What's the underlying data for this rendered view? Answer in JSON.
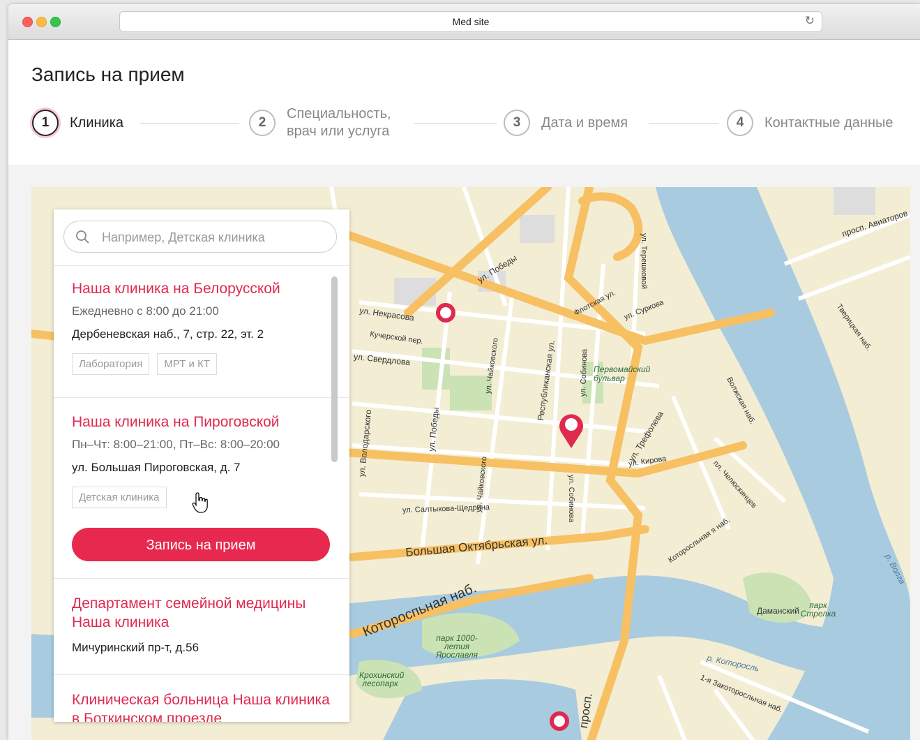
{
  "browser": {
    "url_title": "Med site"
  },
  "page": {
    "title": "Запись на прием"
  },
  "steps": [
    {
      "number": "1",
      "label": "Клиника"
    },
    {
      "number": "2",
      "label": "Специальность,\nврач или услуга"
    },
    {
      "number": "3",
      "label": "Дата и время"
    },
    {
      "number": "4",
      "label": "Контактные данные"
    }
  ],
  "search": {
    "placeholder": "Например, Детская клиника"
  },
  "clinics": [
    {
      "name": "Наша клиника на Белорусской",
      "hours": "Ежедневно с 8:00 до 21:00",
      "address": "Дербеневская наб., 7, стр. 22, эт. 2",
      "tags": [
        "Лаборатория",
        "МРТ и КТ"
      ]
    },
    {
      "name": "Наша клиника на Пироговской",
      "hours": "Пн–Чт: 8:00–21:00, Пт–Вс: 8:00–20:00",
      "address": "ул. Большая Пироговская, д. 7",
      "tags": [
        "Детская клиника"
      ],
      "button": "Запись на прием"
    },
    {
      "name": "Департамент семейной медицины Наша клиника",
      "address": "Мичуринский пр-т, д.56"
    },
    {
      "name": "Клиническая больница Наша клиника в Боткинском проезде"
    }
  ],
  "map": {
    "labels": [
      "ул. Некрасова",
      "Кучерской пер.",
      "ул. Свердлова",
      "ул. Победы",
      "ул. Чайковского",
      "Республиканская ул.",
      "ул. Собинова",
      "Первомайский бульвар",
      "ул. Терешковой",
      "Флотская ул.",
      "ул. Суркова",
      "ул. Трефолева",
      "ул. Кирова",
      "ул. Салтыкова-Щедрина",
      "Большая Октябрьская ул.",
      "Котороспьная наб.",
      "Которосльная я наб.",
      "Волжская наб.",
      "пл. Челюскинцев",
      "Тверицкая наб.",
      "просп. Авиаторов",
      "р. Волга",
      "Даманский",
      "парк Стрелка",
      "парк 1000-летия Ярославля",
      "Крохинский лесопарк",
      "р. Которосль",
      "1-я Закоторосльная наб.",
      "просп.",
      "ул. Володарского",
      "ул. Победы",
      "ул. Собинова",
      "ул. Чайковского"
    ],
    "colors": {
      "land": "#f3edd4",
      "water": "#a9cbe0",
      "road": "#f7c063",
      "street": "#ffffff",
      "park": "#cbe2b5",
      "pin": "#e0294f"
    }
  }
}
